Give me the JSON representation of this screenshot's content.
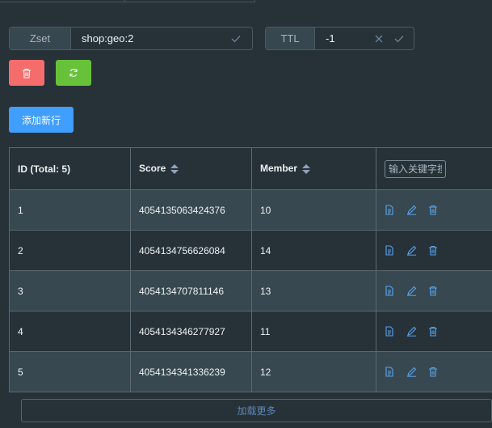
{
  "zset_field": {
    "label": "Zset",
    "value": "shop:geo:2"
  },
  "ttl_field": {
    "label": "TTL",
    "value": "-1"
  },
  "toolbar": {
    "delete_icon": "trash-icon",
    "refresh_icon": "refresh-icon",
    "add_label": "添加新行"
  },
  "table": {
    "headers": {
      "id": "ID (Total: 5)",
      "score": "Score",
      "member": "Member"
    },
    "search_placeholder": "输入关键字搜",
    "rows": [
      {
        "id": "1",
        "score": "4054135063424376",
        "member": "10"
      },
      {
        "id": "2",
        "score": "4054134756626084",
        "member": "14"
      },
      {
        "id": "3",
        "score": "4054134707811146",
        "member": "13"
      },
      {
        "id": "4",
        "score": "4054134346277927",
        "member": "11"
      },
      {
        "id": "5",
        "score": "4054134341336239",
        "member": "12"
      }
    ],
    "row_action_icons": [
      "document-icon",
      "edit-icon",
      "trash-icon"
    ]
  },
  "load_more_label": "加载更多",
  "colors": {
    "accent": "#409eff",
    "danger": "#f56c6c",
    "success": "#67c23a",
    "background": "#263238"
  }
}
